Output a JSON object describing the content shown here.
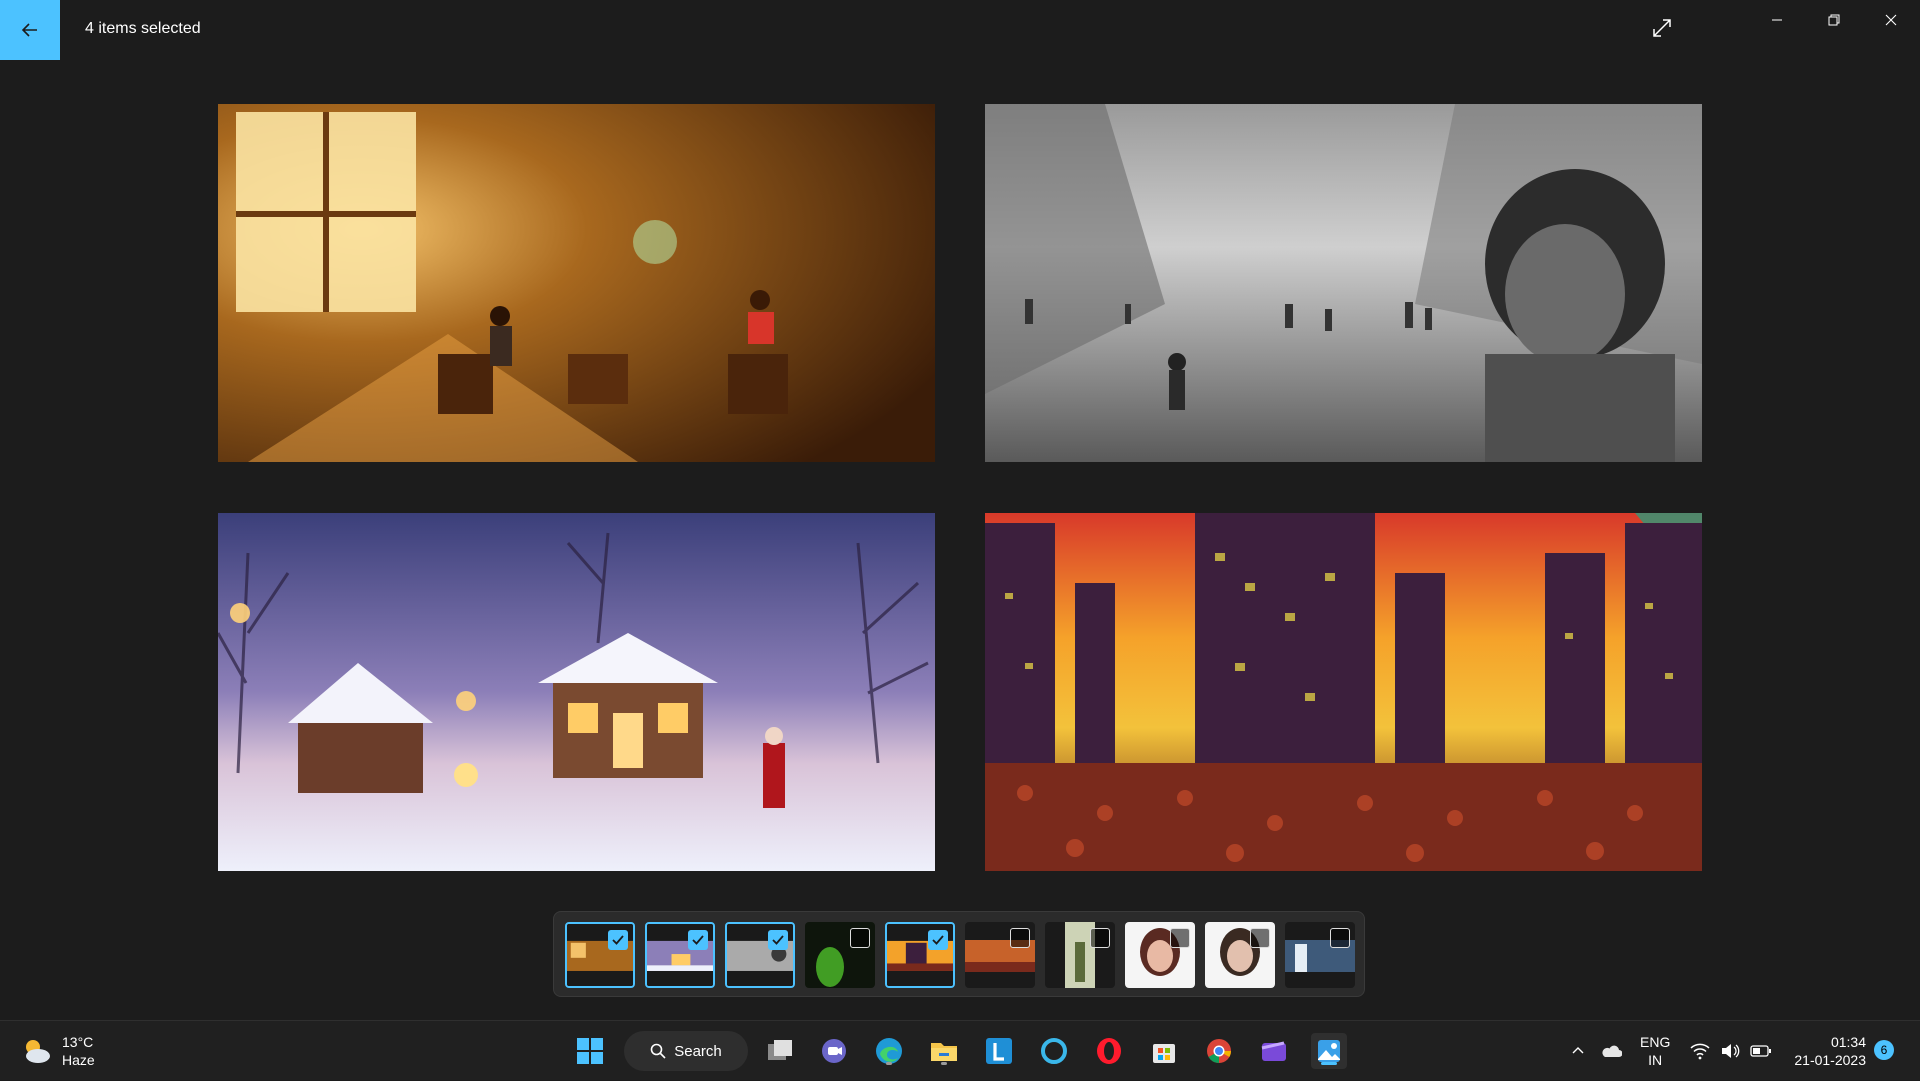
{
  "titlebar": {
    "title": "4 items selected",
    "back_label": "Back",
    "expand_label": "Expand",
    "minimize_label": "Minimize",
    "restore_label": "Restore",
    "close_label": "Close"
  },
  "photos": [
    {
      "name": "reading-room",
      "alt": "Children reading in a sunlit room"
    },
    {
      "name": "rainy-street",
      "alt": "Black and white street scene with a boy"
    },
    {
      "name": "winter-cottage",
      "alt": "Snowy cottage at dusk"
    },
    {
      "name": "city-crowd",
      "alt": "Colorful city skyline with crowd"
    }
  ],
  "filmstrip": [
    {
      "name": "reading-room",
      "selected": true
    },
    {
      "name": "winter-cottage",
      "selected": true
    },
    {
      "name": "rainy-street",
      "selected": true
    },
    {
      "name": "green-figure",
      "selected": false
    },
    {
      "name": "city-crowd",
      "selected": true
    },
    {
      "name": "city-crowd-2",
      "selected": false
    },
    {
      "name": "standing-figure",
      "selected": false
    },
    {
      "name": "portrait-1",
      "selected": false
    },
    {
      "name": "portrait-2",
      "selected": false
    },
    {
      "name": "waterfall",
      "selected": false
    }
  ],
  "taskbar": {
    "weather": {
      "temp": "13°C",
      "condition": "Haze",
      "icon": "partly-cloudy-icon"
    },
    "search_label": "Search",
    "apps": [
      {
        "name": "start",
        "icon": "windows-icon"
      },
      {
        "name": "task-view",
        "icon": "task-view-icon"
      },
      {
        "name": "teams",
        "icon": "teams-icon"
      },
      {
        "name": "edge",
        "icon": "edge-icon"
      },
      {
        "name": "file-explorer",
        "icon": "folder-icon"
      },
      {
        "name": "l-app",
        "icon": "l-icon"
      },
      {
        "name": "cortana",
        "icon": "circle-icon"
      },
      {
        "name": "opera",
        "icon": "opera-icon"
      },
      {
        "name": "store",
        "icon": "store-icon"
      },
      {
        "name": "chrome",
        "icon": "chrome-icon"
      },
      {
        "name": "clipchamp",
        "icon": "clipchamp-icon"
      },
      {
        "name": "photos",
        "icon": "photos-icon"
      }
    ],
    "lang_line1": "ENG",
    "lang_line2": "IN",
    "time": "01:34",
    "date": "21-01-2023",
    "notification_count": "6"
  },
  "colors": {
    "accent": "#4cc2ff",
    "background": "#1c1c1c",
    "taskbar": "#202020"
  }
}
